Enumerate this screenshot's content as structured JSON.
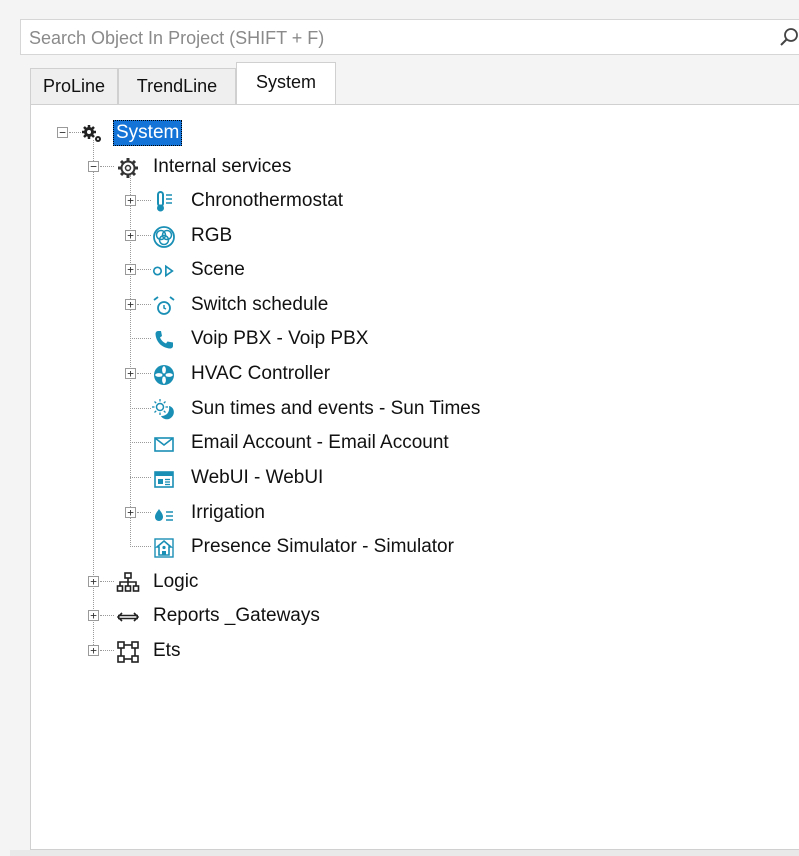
{
  "search": {
    "placeholder": "Search Object In Project (SHIFT + F)"
  },
  "tabs": [
    {
      "label": "ProLine"
    },
    {
      "label": "TrendLine"
    },
    {
      "label": "System",
      "active": true
    }
  ],
  "colors": {
    "accent": "#1a8fb5",
    "selection": "#1473d6"
  },
  "tree": {
    "root": {
      "label": "System",
      "icon": "gears-icon",
      "expanded": true,
      "selected": true
    },
    "internal": {
      "label": "Internal services",
      "icon": "gear-icon",
      "expanded": true
    },
    "chrono": {
      "label": "Chronothermostat",
      "icon": "thermometer-icon",
      "expandable": true
    },
    "rgb": {
      "label": "RGB",
      "icon": "rgb-circles-icon",
      "expandable": true
    },
    "scene": {
      "label": "Scene",
      "icon": "scene-play-icon",
      "expandable": true
    },
    "switch": {
      "label": "Switch schedule",
      "icon": "alarm-clock-icon",
      "expandable": true
    },
    "voip": {
      "label": "Voip PBX - Voip PBX",
      "icon": "phone-icon",
      "expandable": false
    },
    "hvac": {
      "label": "HVAC Controller",
      "icon": "fan-icon",
      "expandable": true
    },
    "sun": {
      "label": "Sun times and events - Sun Times",
      "icon": "sun-moon-icon",
      "expandable": false
    },
    "email": {
      "label": "Email Account - Email Account",
      "icon": "envelope-icon",
      "expandable": false
    },
    "webui": {
      "label": "WebUI - WebUI",
      "icon": "web-window-icon",
      "expandable": false
    },
    "irrigation": {
      "label": "Irrigation",
      "icon": "water-drop-icon",
      "expandable": true
    },
    "presence": {
      "label": "Presence Simulator - Simulator",
      "icon": "house-person-icon",
      "expandable": false
    },
    "logic": {
      "label": "Logic",
      "icon": "hierarchy-icon",
      "expandable": true
    },
    "reports": {
      "label": "Reports _Gateways",
      "icon": "arrows-left-right-icon",
      "expandable": true
    },
    "ets": {
      "label": "Ets",
      "icon": "network-icon",
      "expandable": true
    }
  }
}
